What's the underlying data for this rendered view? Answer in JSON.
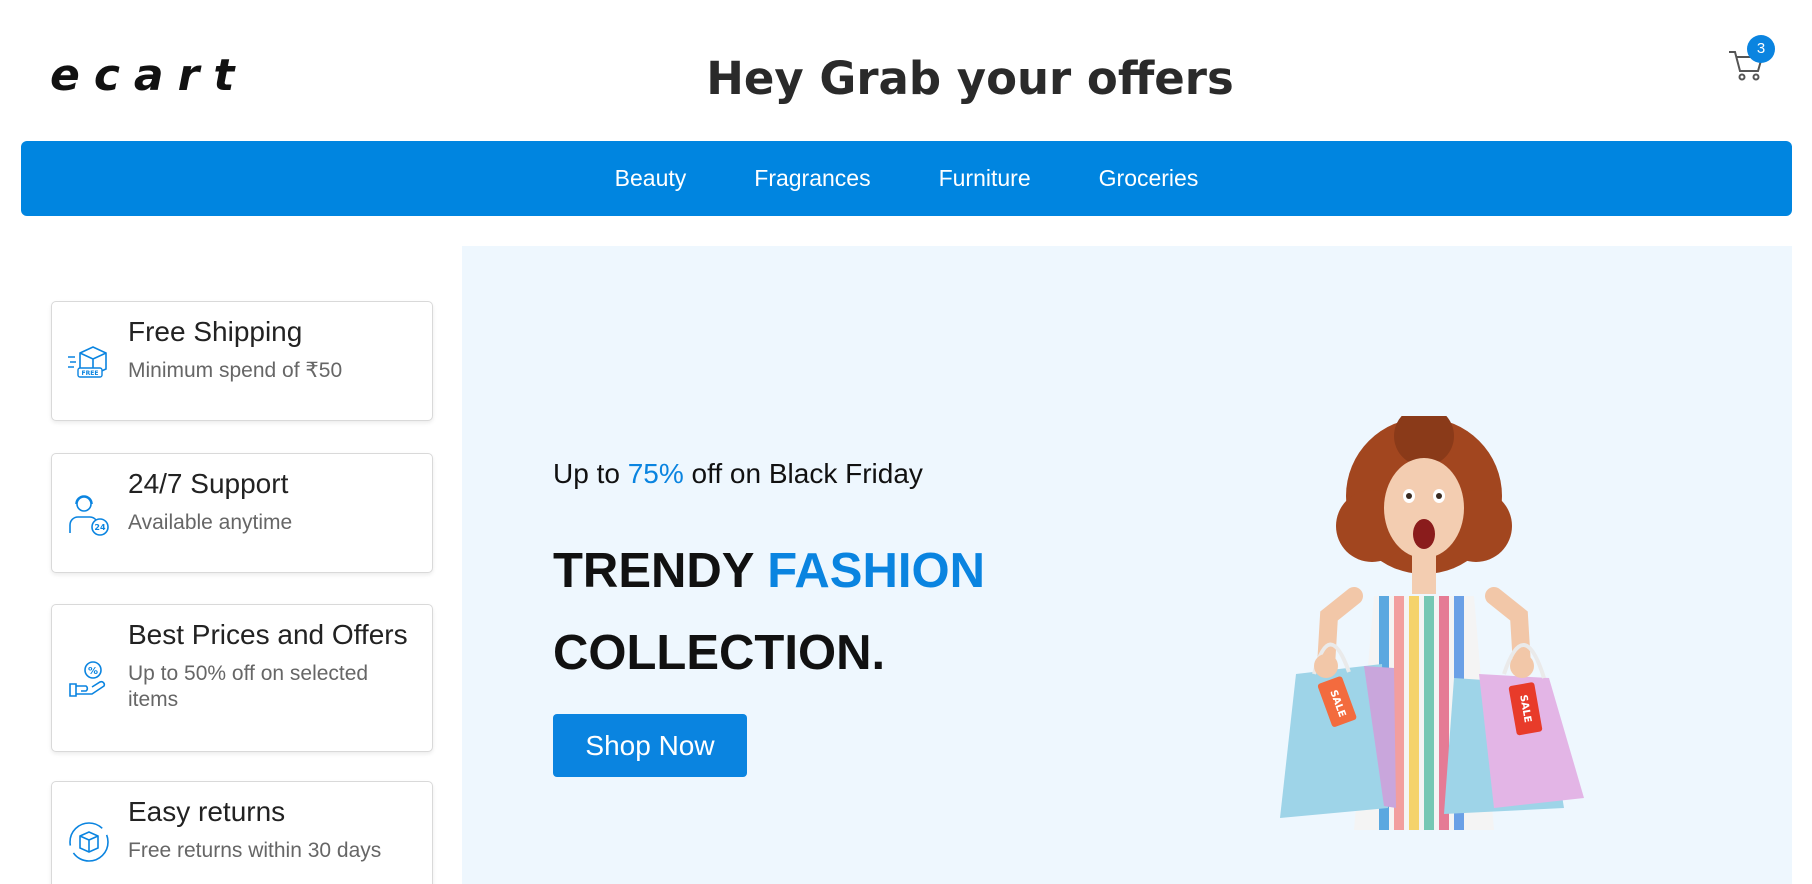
{
  "header": {
    "logo": "ecart",
    "headline": "Hey Grab your offers",
    "cart_count": "3",
    "cart_icon": "shopping-cart-icon"
  },
  "nav": {
    "items": [
      {
        "label": "Beauty"
      },
      {
        "label": "Fragrances"
      },
      {
        "label": "Furniture"
      },
      {
        "label": "Groceries"
      }
    ]
  },
  "features": [
    {
      "title": "Free Shipping",
      "desc": "Minimum spend of ₹50",
      "icon": "free-shipping-box-icon"
    },
    {
      "title": "24/7 Support",
      "desc": "Available anytime",
      "icon": "support-agent-icon"
    },
    {
      "title": "Best Prices and Offers",
      "desc": "Up to 50% off on selected items",
      "icon": "discount-hand-icon"
    },
    {
      "title": "Easy returns",
      "desc": "Free returns within 30 days",
      "icon": "return-box-icon"
    }
  ],
  "hero": {
    "sub_prefix": "Up to ",
    "sub_accent": "75%",
    "sub_suffix": " off on Black Friday",
    "title_line1": "TRENDY ",
    "title_accent": "FASHION",
    "title_line2": "COLLECTION.",
    "button_label": "Shop Now",
    "image_tag_left": "SALE",
    "image_tag_right": "SALE"
  },
  "colors": {
    "accent": "#0a84e0",
    "nav_bg": "#0085e0",
    "hero_bg": "#eef7fe"
  }
}
